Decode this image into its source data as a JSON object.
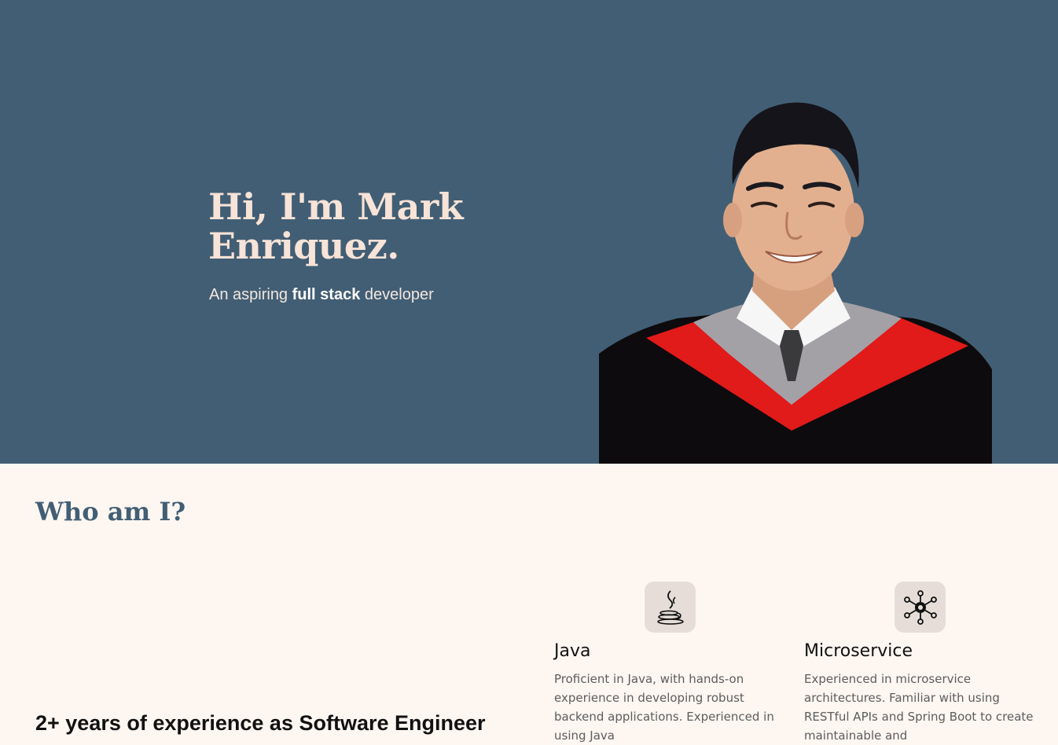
{
  "hero": {
    "greeting": "Hi, I'm Mark Enriquez.",
    "tagline_prefix": "An aspiring ",
    "tagline_emphasis": "full stack",
    "tagline_suffix": " developer",
    "background_color": "#425e74"
  },
  "about": {
    "heading": "Who am I?",
    "experience_headline": "2+ years of experience as Software Engineer"
  },
  "skills": [
    {
      "title": "Java",
      "icon": "java-icon",
      "description": "Proficient in Java, with hands-on experience in developing robust backend applications. Experienced in using Java"
    },
    {
      "title": "Microservice",
      "icon": "microservice-icon",
      "description": "Experienced in microservice architectures. Familiar with using RESTful APIs and Spring Boot to create maintainable and"
    }
  ],
  "colors": {
    "accent": "#425e74",
    "page_background": "#fdf6f1",
    "heading_text": "#f7e3d7",
    "icon_tile": "#e6ddd8"
  }
}
